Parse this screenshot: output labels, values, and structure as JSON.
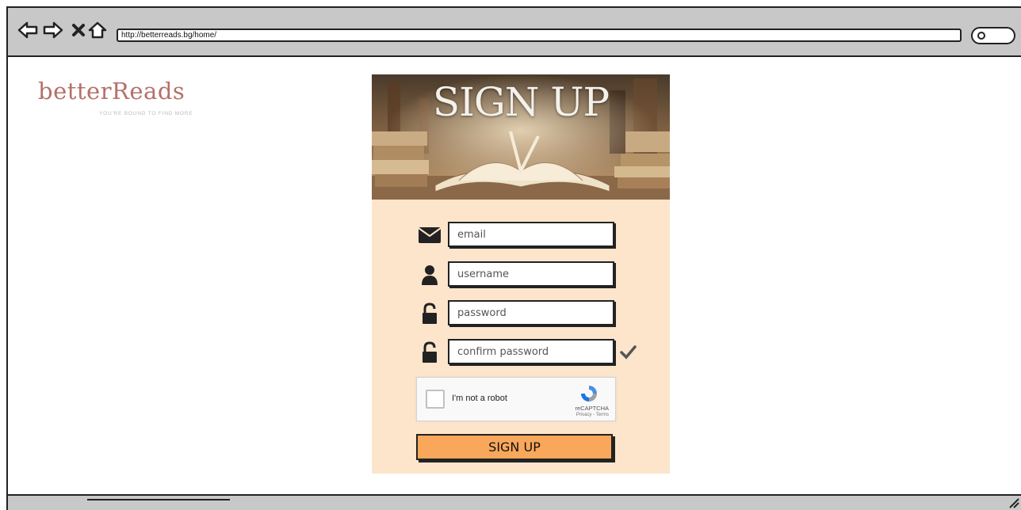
{
  "browser": {
    "url": "http://betterreads.bg/home/",
    "nav": {
      "back_icon": "arrow-left-icon",
      "forward_icon": "arrow-right-icon",
      "close_icon": "close-x-icon",
      "home_icon": "home-icon"
    },
    "search_icon": "search-icon"
  },
  "logo": {
    "title": "betterReads",
    "tagline": "YOU'RE BOUND TO FIND MORE"
  },
  "signup": {
    "hero_title": "SIGN UP",
    "fields": {
      "email": {
        "placeholder": "email",
        "icon": "envelope-icon"
      },
      "username": {
        "placeholder": "username",
        "icon": "user-icon"
      },
      "password": {
        "placeholder": "password",
        "icon": "unlock-icon"
      },
      "confirm_password": {
        "placeholder": "confirm password",
        "icon": "unlock-icon",
        "validated_icon": "checkmark-icon"
      }
    },
    "captcha": {
      "label": "I'm not a robot",
      "brand": "reCAPTCHA",
      "links": "Privacy - Terms"
    },
    "submit_label": "SIGN UP"
  },
  "colors": {
    "card_bg": "#fde5cc",
    "button_bg": "#f9a75a",
    "logo_text": "#b5706a",
    "chrome_bg": "#c8c8c8"
  }
}
